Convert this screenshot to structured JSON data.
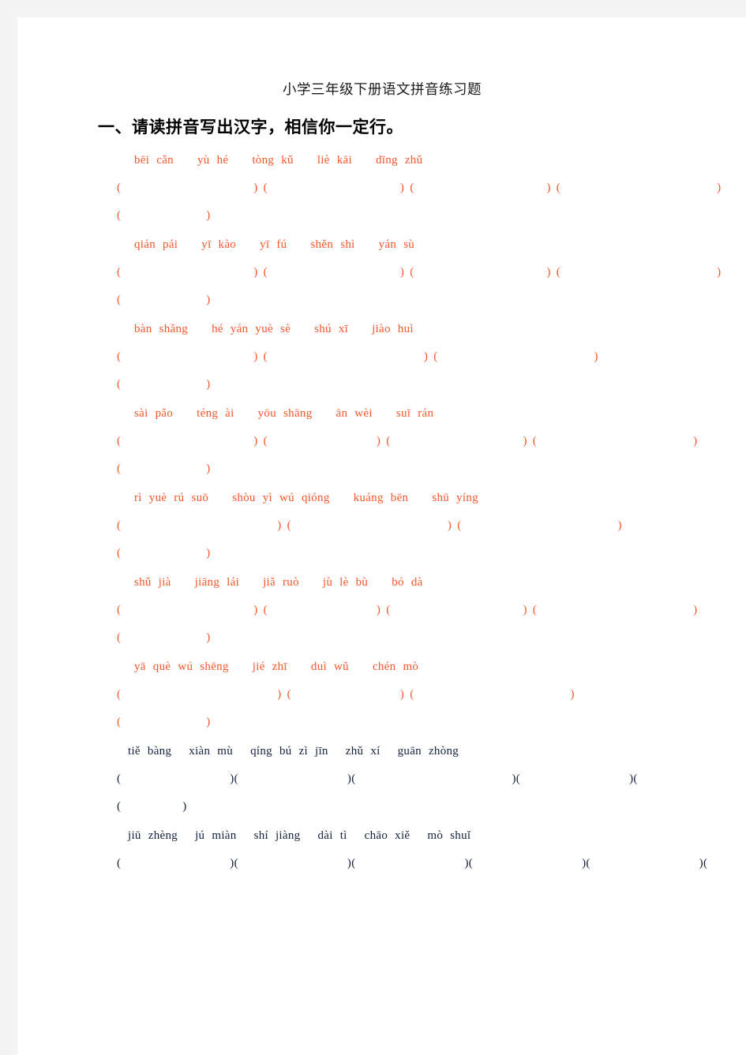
{
  "document": {
    "title": "小学三年级下册语文拼音练习题",
    "section_heading": "一、请读拼音写出汉字，相信你一定行。",
    "pinyin_color": "#f8572b",
    "dark_color": "#14203c"
  },
  "exercises": [
    {
      "index": 1,
      "color": "orange",
      "words": [
        [
          "bēi",
          "cǎn"
        ],
        [
          "yù",
          "hé"
        ],
        [
          "tòng",
          "kǔ"
        ],
        [
          "liè",
          "kāi"
        ],
        [
          "dīng",
          "zhǔ"
        ]
      ],
      "answers": [
        "(　　　　)",
        "(　　　　)",
        "(　　　　)",
        "(　　　　)",
        "(　　　　)"
      ],
      "blanks_row1": 4,
      "blanks_row2": 1
    },
    {
      "index": 2,
      "color": "orange",
      "words": [
        [
          "qián",
          "pái"
        ],
        [
          "yī",
          "kào"
        ],
        [
          "yī",
          "fú"
        ],
        [
          "shěn",
          "shì"
        ],
        [
          "yán",
          "sù"
        ]
      ],
      "answers": [
        "(　　　　)",
        "(　　　　)",
        "(　　　　)",
        "(　　　　)",
        "(　　　　)"
      ],
      "blanks_row1": 4,
      "blanks_row2": 1
    },
    {
      "index": 3,
      "color": "orange",
      "words": [
        [
          "bàn",
          "shǎng"
        ],
        [
          "hé",
          "yán",
          "yuè",
          "sè"
        ],
        [
          "shú",
          "xī"
        ],
        [
          "jiào",
          "huì"
        ]
      ],
      "answers": [
        "(　　　　)",
        "(　　　　)",
        "(　　　　)",
        "(　　　　)"
      ],
      "blanks_row1": 3,
      "blanks_row2": 1
    },
    {
      "index": 4,
      "color": "orange",
      "words": [
        [
          "sài",
          "pǎo"
        ],
        [
          "téng",
          "ài"
        ],
        [
          "yōu",
          "shāng"
        ],
        [
          "ān",
          "wèi"
        ],
        [
          "suī",
          "rán"
        ]
      ],
      "answers": [
        "(　　　　)",
        "(　　　　)",
        "(　　　　)",
        "(　　　　)",
        "(　　　　)"
      ],
      "blanks_row1": 4,
      "blanks_row2": 1
    },
    {
      "index": 5,
      "color": "orange",
      "words": [
        [
          "rì",
          "yuè",
          "rú",
          "suō"
        ],
        [
          "shòu",
          "yì",
          "wú",
          "qióng"
        ],
        [
          "kuáng",
          "bēn"
        ],
        [
          "shū",
          "yíng"
        ]
      ],
      "answers": [
        "(　　　　)",
        "(　　　　)",
        "(　　　　)",
        "(　　　　)"
      ],
      "blanks_row1": 3,
      "blanks_row2": 1
    },
    {
      "index": 6,
      "color": "orange",
      "words": [
        [
          "shǔ",
          "jià"
        ],
        [
          "jiāng",
          "lái"
        ],
        [
          "jiǎ",
          "ruò"
        ],
        [
          "jù",
          "lè",
          "bù"
        ],
        [
          "bó",
          "dà"
        ]
      ],
      "answers": [
        "(　　　　)",
        "(　　　　)",
        "(　　　　)",
        "(　　　　)",
        "(　　　　)"
      ],
      "blanks_row1": 4,
      "blanks_row2": 1
    },
    {
      "index": 7,
      "color": "orange",
      "words": [
        [
          "yā",
          "què",
          "wú",
          "shēng"
        ],
        [
          "jié",
          "zhī"
        ],
        [
          "duì",
          "wǔ"
        ],
        [
          "chén",
          "mò"
        ]
      ],
      "answers": [
        "(　　　　)",
        "(　　　　)",
        "(　　　　)",
        "(　　　　)"
      ],
      "blanks_row1": 3,
      "blanks_row2": 1
    },
    {
      "index": 8,
      "color": "dark",
      "words": [
        [
          "tiě",
          "bàng"
        ],
        [
          "xiàn",
          "mù"
        ],
        [
          "qíng",
          "bú",
          "zì",
          "jīn"
        ],
        [
          "zhǔ",
          "xí"
        ],
        [
          "guān",
          "zhòng"
        ]
      ],
      "answers": [
        "(　　　　)",
        "(　　　　)",
        "(　　　　)",
        "(　　　　)",
        "(　　　　)"
      ],
      "blanks_row1": 5,
      "blanks_row2": 1
    },
    {
      "index": 9,
      "color": "dark",
      "words": [
        [
          "jiū",
          "zhèng"
        ],
        [
          "jú",
          "miàn"
        ],
        [
          "shí",
          "jiàng"
        ],
        [
          "dài",
          "tì"
        ],
        [
          "chāo",
          "xiě"
        ],
        [
          "mò",
          "shuǐ"
        ]
      ],
      "answers": [
        "(　　　　)",
        "(　　　　)",
        "(　　　　)",
        "(　　　　)",
        "(　　　　)",
        "(　　　　)"
      ],
      "blanks_row1": 6,
      "blanks_row2": 0,
      "wraps": true
    }
  ],
  "brackets": {
    "left": "(",
    "right": ")"
  }
}
